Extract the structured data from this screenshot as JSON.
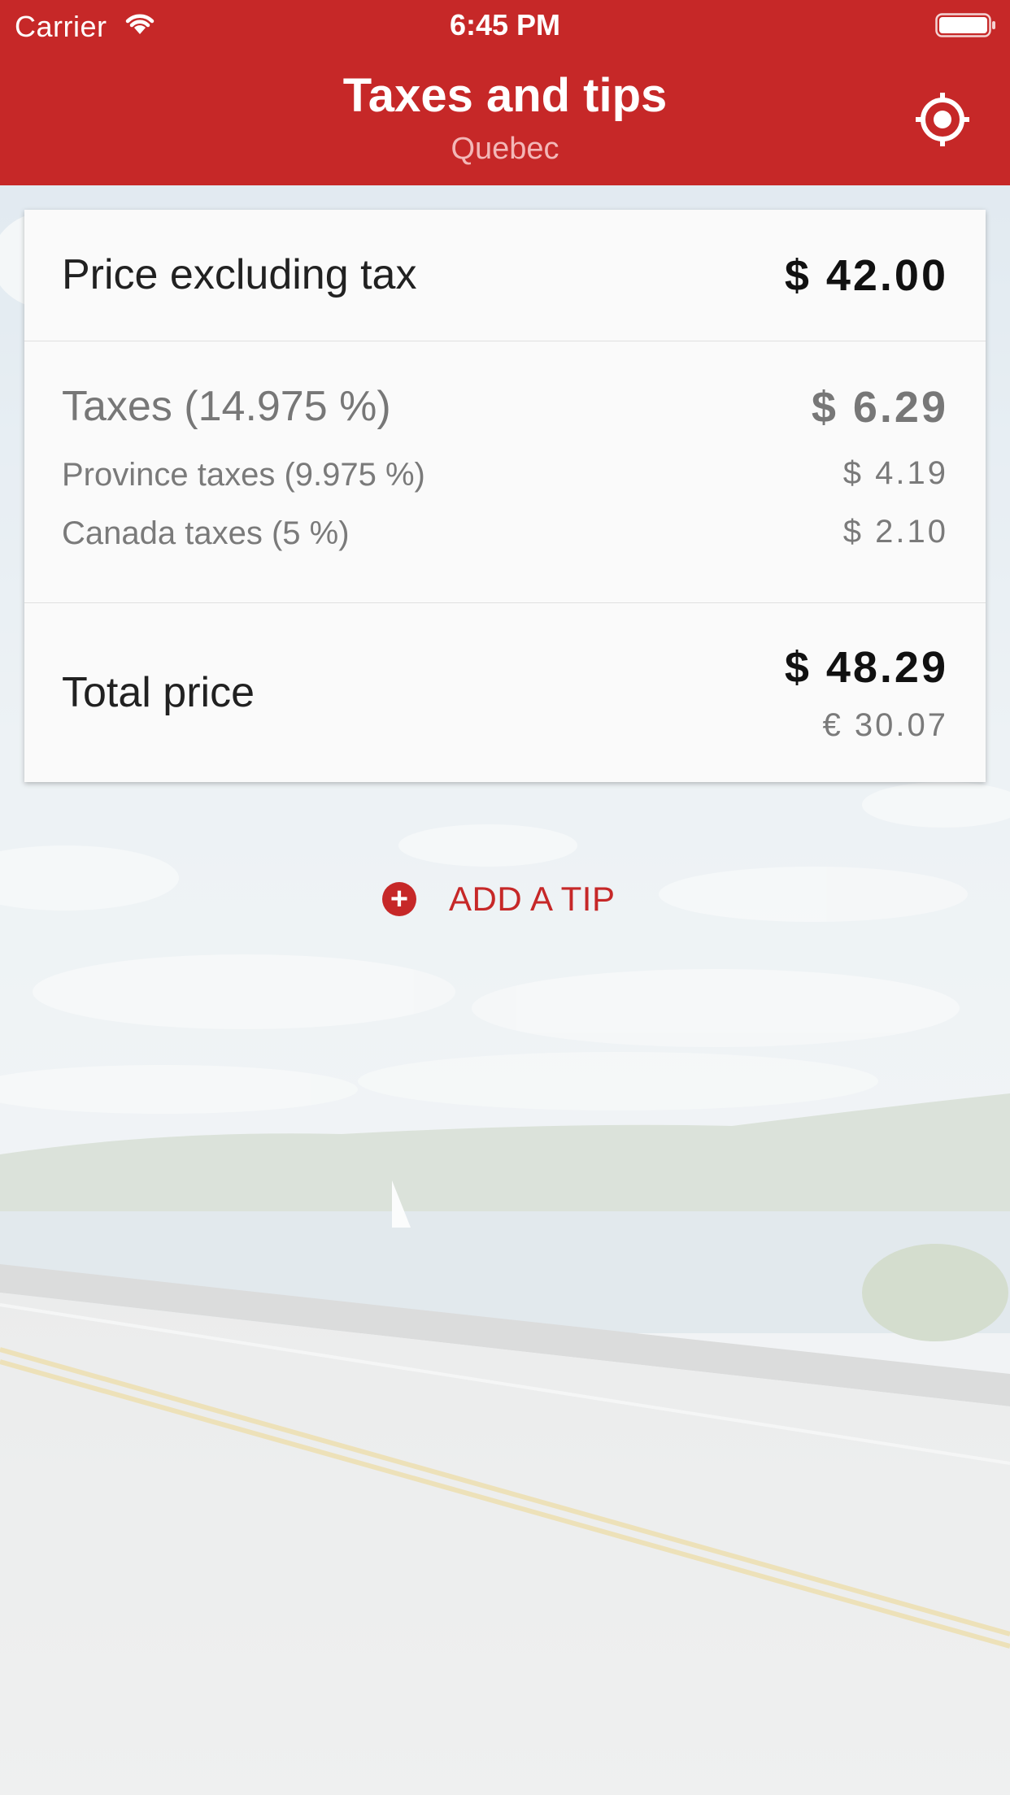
{
  "status_bar": {
    "carrier": "Carrier",
    "time": "6:45 PM",
    "wifi_icon": "wifi-icon",
    "battery_icon": "battery-icon"
  },
  "header": {
    "title": "Taxes and tips",
    "subtitle": "Quebec",
    "locate_icon": "locate-icon",
    "background_color": "#c62828"
  },
  "card": {
    "price": {
      "label": "Price excluding tax",
      "value": "$ 42.00"
    },
    "taxes": {
      "label": "Taxes (14.975 %)",
      "value": "$ 6.29",
      "province": {
        "label": "Province taxes (9.975 %)",
        "value": "$ 4.19"
      },
      "canada": {
        "label": "Canada taxes (5 %)",
        "value": "$ 2.10"
      }
    },
    "total": {
      "label": "Total price",
      "value": "$ 48.29",
      "converted": "€ 30.07"
    }
  },
  "tip": {
    "icon": "plus-circle-icon",
    "label": "ADD A TIP",
    "accent_color": "#c62828"
  }
}
